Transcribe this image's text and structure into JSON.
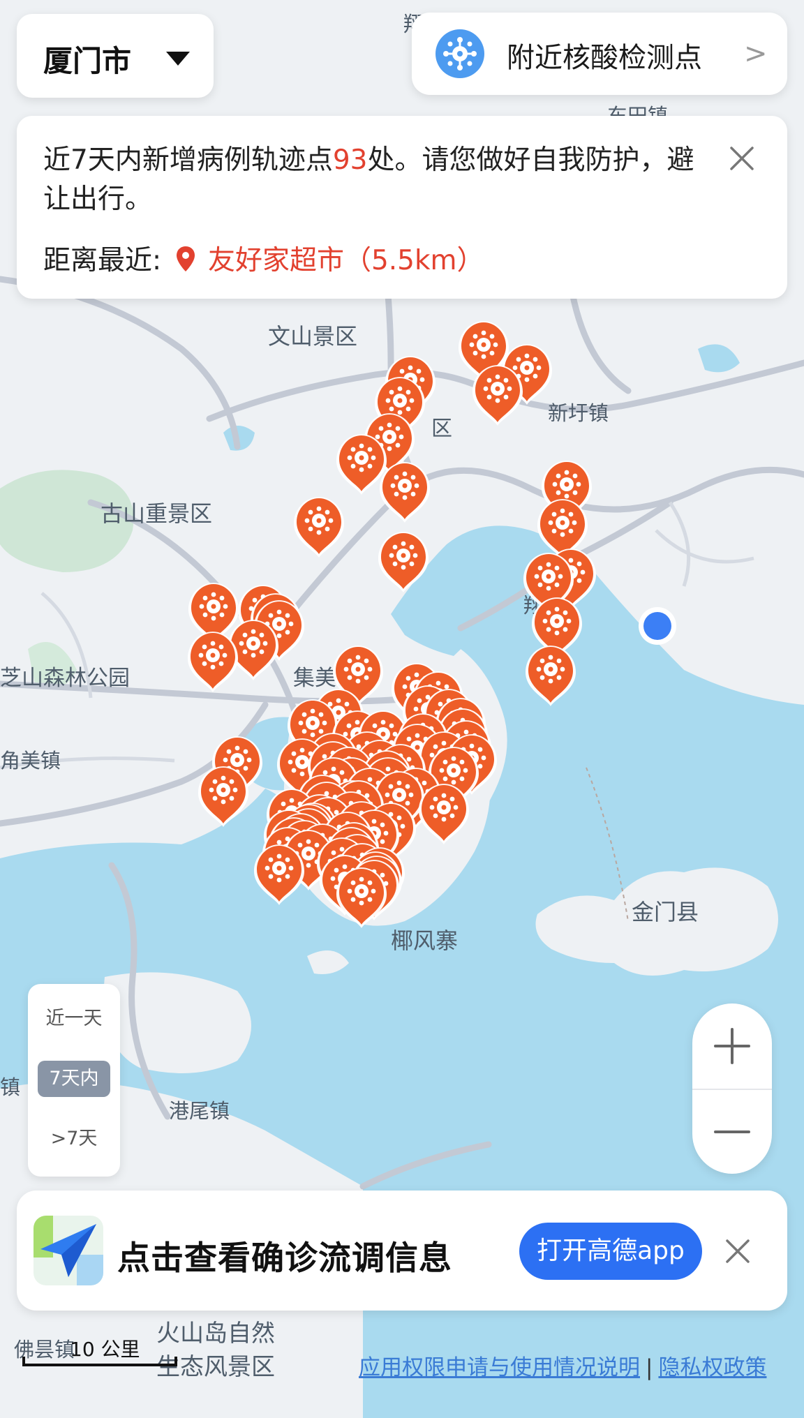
{
  "city_selector": {
    "label": "厦门市"
  },
  "testing_sites": {
    "label": "附近核酸检测点",
    "chevron": ">"
  },
  "alert": {
    "text_before": "近7天内新增病例轨迹点",
    "count": "93",
    "text_after": "处。请您做好自我防护，避让出行。",
    "nearest_label": "距离最近:",
    "nearest_place": "友好家超市（5.5km）"
  },
  "map_labels": [
    "文山景区",
    "新圩镇",
    "古山重景区",
    "芝山森林公园",
    "集美区",
    "角美镇",
    "金门县",
    "椰风寨",
    "港尾镇",
    "佛昙镇",
    "火山岛自然",
    "生态风景区",
    "东田镇",
    "区",
    "翔",
    "镇",
    "翔"
  ],
  "time_filter": {
    "options": [
      "近一天",
      "7天内",
      ">7天"
    ],
    "selected": "7天内"
  },
  "zoom": {
    "in": "+",
    "out": "−"
  },
  "promo": {
    "title": "点击查看确诊流调信息",
    "button": "打开高德app"
  },
  "scale": {
    "label": "10 公里"
  },
  "footer": {
    "link1": "应用权限申请与使用情况说明",
    "separator": "|",
    "link2": "隐私权政策"
  },
  "colors": {
    "marker": "#ee5d28",
    "accent_red": "#e2412f",
    "button_blue": "#2c70f3",
    "water": "#a9daef",
    "user_location": "#3c7ff5"
  },
  "icons": [
    "virus-icon",
    "close-icon",
    "location-pin-icon",
    "paper-plane-logo",
    "chevron-right-icon",
    "caret-down-icon"
  ]
}
